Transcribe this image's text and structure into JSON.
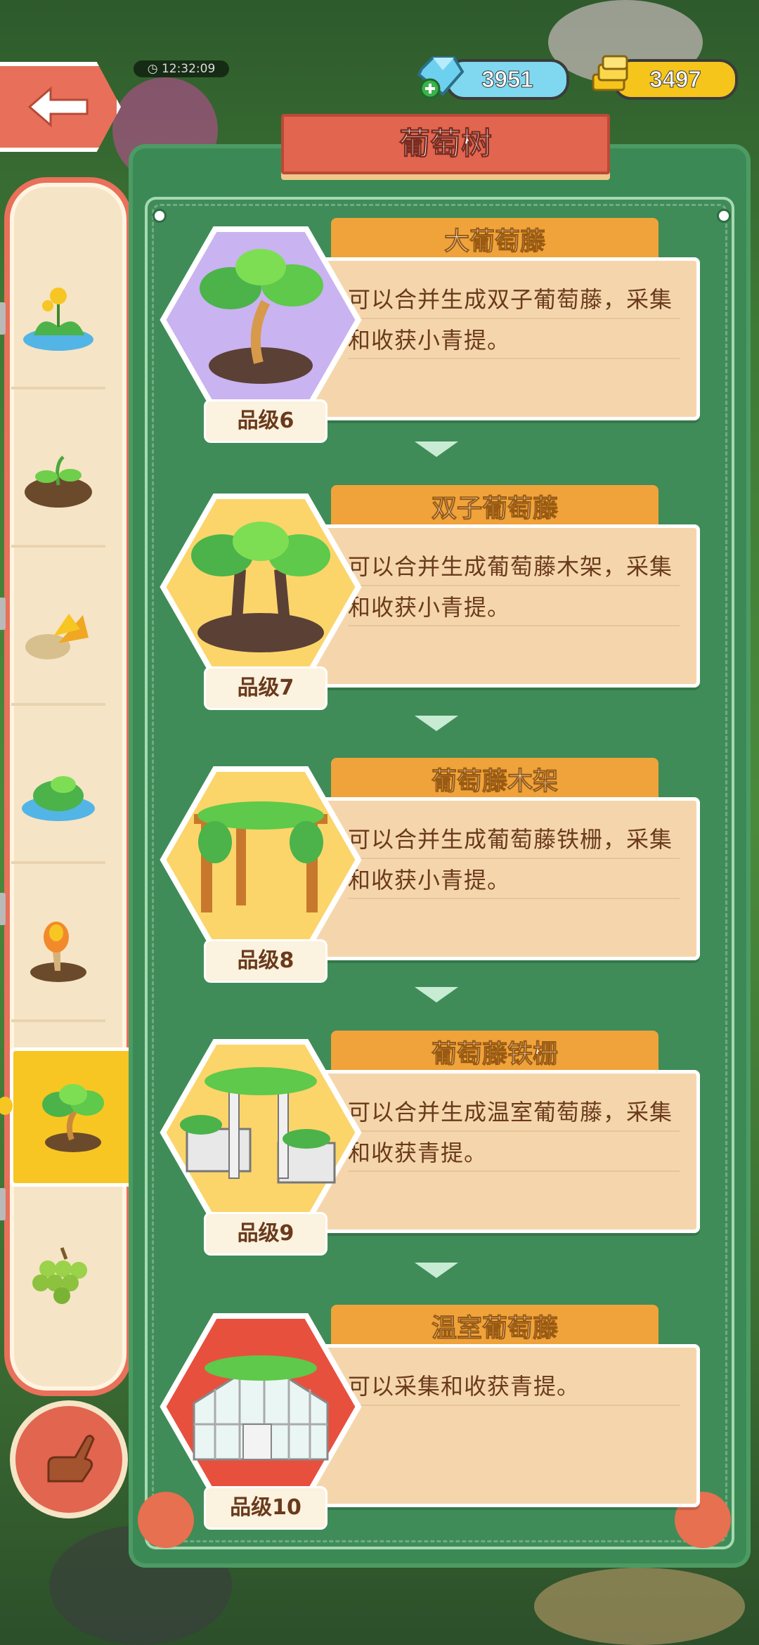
{
  "status_bar": {
    "clock": "12:32:09"
  },
  "currency": {
    "gems": "3951",
    "gold": "3497"
  },
  "panel": {
    "title": "葡萄树"
  },
  "sidebar": {
    "items": [
      {
        "icon": "flower-pond-icon"
      },
      {
        "icon": "sprout-icon"
      },
      {
        "icon": "leaf-rock-icon"
      },
      {
        "icon": "bush-pond-icon"
      },
      {
        "icon": "torch-plant-icon"
      },
      {
        "icon": "grape-tree-icon",
        "active": true
      },
      {
        "icon": "grapes-icon"
      }
    ]
  },
  "cards": [
    {
      "name": "大葡萄藤",
      "desc": "可以合并生成双子葡萄藤，采集和收获小青提。",
      "grade": "品级6",
      "hex_color": "#c9b3f0"
    },
    {
      "name": "双子葡萄藤",
      "desc": "可以合并生成葡萄藤木架，采集和收获小青提。",
      "grade": "品级7",
      "hex_color": "#fbd56a"
    },
    {
      "name": "葡萄藤木架",
      "desc": "可以合并生成葡萄藤铁栅，采集和收获小青提。",
      "grade": "品级8",
      "hex_color": "#fbd56a"
    },
    {
      "name": "葡萄藤铁栅",
      "desc": "可以合并生成温室葡萄藤，采集和收获青提。",
      "grade": "品级9",
      "hex_color": "#fbd56a"
    },
    {
      "name": "温室葡萄藤",
      "desc": "可以采集和收获青提。",
      "grade": "品级10",
      "hex_color": "#e8503e"
    }
  ]
}
